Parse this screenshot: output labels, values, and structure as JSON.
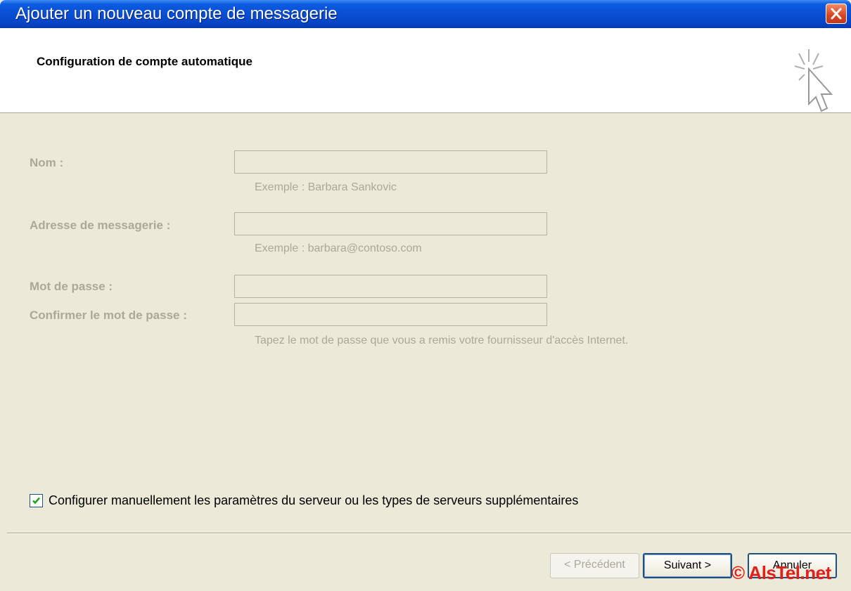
{
  "window": {
    "title": "Ajouter un nouveau compte de messagerie"
  },
  "header": {
    "title": "Configuration de compte automatique"
  },
  "form": {
    "name_label": "Nom :",
    "name_hint": "Exemple : Barbara Sankovic",
    "email_label": "Adresse de messagerie :",
    "email_hint": "Exemple : barbara@contoso.com",
    "password_label": "Mot de passe :",
    "confirm_label": "Confirmer le mot de passe :",
    "password_hint": "Tapez le mot de passe que vous a remis votre fournisseur d'accès Internet."
  },
  "manual_config": {
    "label": "Configurer manuellement les paramètres du serveur ou les types de serveurs supplémentaires",
    "checked": true
  },
  "buttons": {
    "prev": "< Précédent",
    "next": "Suivant >",
    "cancel": "Annuler"
  },
  "watermark": "© AlsTel.net",
  "colors": {
    "titlebar": "#0a4fd4",
    "dialog_bg": "#ece9d8",
    "disabled_text": "#aca899",
    "watermark": "#e0211b"
  },
  "icons": {
    "close": "close-icon",
    "wizard": "wizard-cursor-icon",
    "check": "checkmark-icon"
  }
}
